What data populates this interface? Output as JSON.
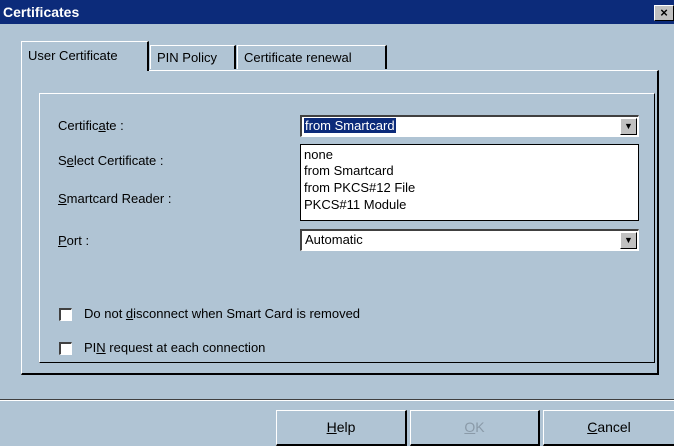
{
  "window": {
    "title": "Certificates",
    "close_glyph": "×"
  },
  "tabs": [
    {
      "label": "User Certificate",
      "active": true
    },
    {
      "label": "PIN Policy",
      "active": false
    },
    {
      "label": "Certificate renewal",
      "active": false
    }
  ],
  "form": {
    "certificate": {
      "label_pre": "Certific",
      "label_mn": "a",
      "label_post": "te :",
      "value": "from Smartcard",
      "options": [
        "none",
        "from Smartcard",
        "from PKCS#12 File",
        "PKCS#11 Module"
      ]
    },
    "select_certificate": {
      "label_pre": "S",
      "label_mn": "e",
      "label_post": "lect Certificate :"
    },
    "smartcard_reader": {
      "label_pre": "",
      "label_mn": "S",
      "label_post": "martcard Reader :"
    },
    "port": {
      "label_pre": "",
      "label_mn": "P",
      "label_post": "ort :",
      "value": "Automatic"
    }
  },
  "checkboxes": [
    {
      "pre": "Do not ",
      "mn": "d",
      "post": "isconnect when Smart Card is removed",
      "checked": false
    },
    {
      "pre": "PI",
      "mn": "N",
      "post": " request at each connection",
      "checked": false
    }
  ],
  "buttons": {
    "help": {
      "mn": "H",
      "post": "elp"
    },
    "ok": {
      "mn": "O",
      "post": "K",
      "enabled": false
    },
    "cancel": {
      "mn": "C",
      "post": "ancel"
    }
  },
  "colors": {
    "titlebar": "#0c2b7a",
    "dialog_bg": "#b0c4d4",
    "selection": "#0c2b7a"
  },
  "icons": {
    "dropdown_arrow": "▼"
  }
}
